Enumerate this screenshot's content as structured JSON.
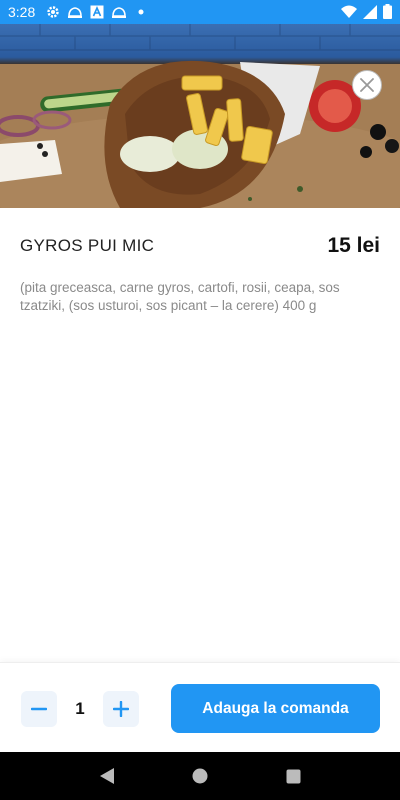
{
  "status_bar": {
    "time": "3:28",
    "icons": [
      "gear-icon",
      "bell-icon",
      "a-icon",
      "bell-icon",
      "dot-icon"
    ],
    "right_icons": [
      "wifi-icon",
      "signal-icon",
      "battery-icon"
    ]
  },
  "product": {
    "title": "GYROS PUI MIC",
    "price": "15 lei",
    "description": "(pita greceasca, carne gyros, cartofi, rosii, ceapa, sos tzatziki, (sos usturoi, sos picant – la cerere) 400 g"
  },
  "order": {
    "quantity": "1",
    "add_label": "Adauga la comanda"
  },
  "colors": {
    "accent": "#2196f3",
    "qty_bg": "#eef4fb"
  }
}
